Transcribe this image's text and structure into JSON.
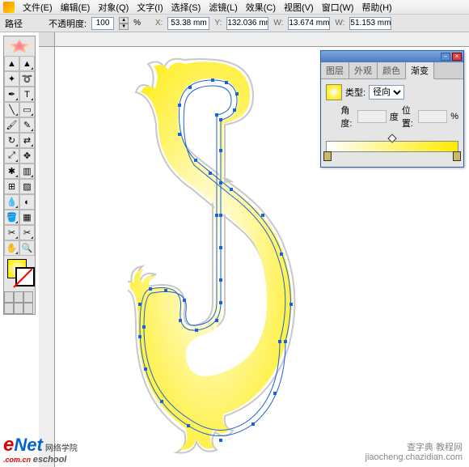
{
  "menu": {
    "file": "文件(E)",
    "edit": "编辑(E)",
    "object": "对象(Q)",
    "type": "文字(I)",
    "select": "选择(S)",
    "filter": "滤镜(L)",
    "effect": "效果(C)",
    "view": "视图(V)",
    "window": "窗口(W)",
    "help": "帮助(H)"
  },
  "options": {
    "mode": "路径",
    "opacity_label": "不透明度:",
    "opacity": "100",
    "opacity_unit": "%",
    "x_key": "X:",
    "x": "53.38 mm",
    "y_key": "Y:",
    "y": "132.036 mm",
    "w_key": "W:",
    "w": "13.674 mm",
    "h_key": "W:",
    "h": "51.153 mm"
  },
  "panel": {
    "tabs": {
      "layers": "图层",
      "appearance": "外观",
      "color": "颜色",
      "gradient": "渐变"
    },
    "type_label": "类型:",
    "type_value": "径向",
    "angle_label": "角度:",
    "angle_unit": "度",
    "loc_label": "位置:",
    "loc_unit": "%"
  },
  "watermark": {
    "enet_e": "e",
    "enet_net": "Net",
    "enet_sub": ".com.cn",
    "enet_cn": "eschool",
    "enet_label": "网络学院",
    "right1": "查字典  教程网",
    "right2": "jiaocheng.chazidian.com"
  }
}
